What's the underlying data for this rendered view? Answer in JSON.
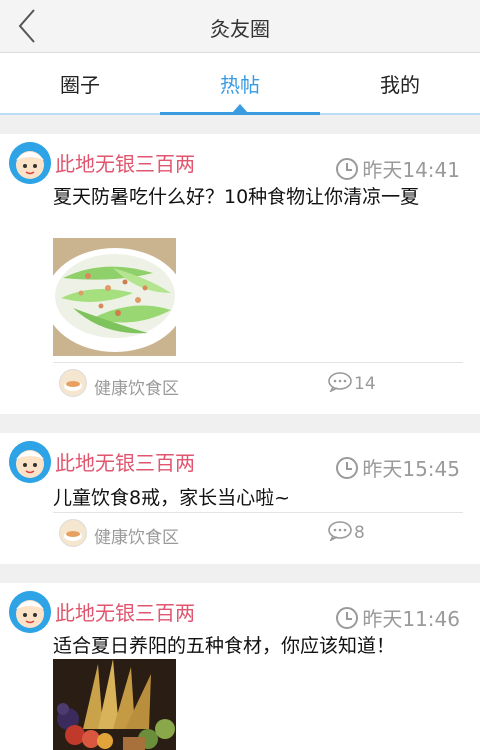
{
  "header": {
    "title": "灸友圈",
    "back_icon": "chevron-left-icon"
  },
  "tabs": [
    {
      "label": "圈子",
      "active": false
    },
    {
      "label": "热帖",
      "active": true
    },
    {
      "label": "我的",
      "active": false
    }
  ],
  "accent_color": "#3a9be0",
  "author_color": "#e0566f",
  "posts": [
    {
      "author": "此地无银三百两",
      "time": "昨天14:41",
      "title": "夏天防暑吃什么好？10种食物让你清凉一夏",
      "has_image": true,
      "image_subject": "stir-fried cucumber with shrimp",
      "category": "健康饮食区",
      "comments": "14"
    },
    {
      "author": "此地无银三百两",
      "time": "昨天15:45",
      "title": "儿童饮食8戒，家长当心啦~",
      "has_image": false,
      "category": "健康饮食区",
      "comments": "8"
    },
    {
      "author": "此地无银三百两",
      "time": "昨天11:46",
      "title": "适合夏日养阳的五种食材，你应该知道！",
      "has_image": true,
      "image_subject": "harvest still life with wheat and fruit"
    }
  ]
}
